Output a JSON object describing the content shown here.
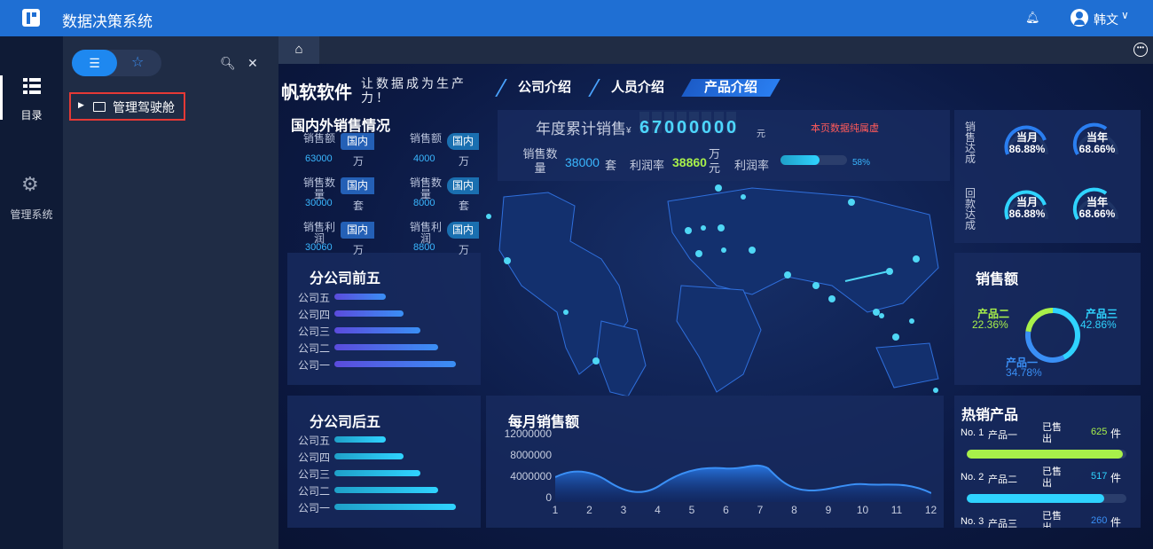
{
  "topbar": {
    "title": "数据决策系统",
    "user": "韩文"
  },
  "nav": {
    "directory": "目录",
    "manage": "管理系统"
  },
  "tree": {
    "item": "管理驾驶舱"
  },
  "dash": {
    "brand": "帆软软件",
    "slogan": "让数据成为生产力！",
    "tabs": [
      "公司介绍",
      "人员介绍",
      "产品介绍"
    ],
    "domestic": {
      "title": "国内外销售情况",
      "rows": [
        {
          "l1": "销售额",
          "v1": "63000",
          "u1": "万",
          "l2": "销售额",
          "v2": "4000",
          "u2": "万"
        },
        {
          "l1": "销售数量",
          "v1": "30000",
          "u1": "套",
          "l2": "销售数量",
          "v2": "8000",
          "u2": "套"
        },
        {
          "l1": "销售利润",
          "v1": "30060",
          "u1": "万",
          "l2": "销售利润",
          "v2": "8800",
          "u2": "万"
        }
      ],
      "pill": "国内"
    },
    "annual": {
      "title": "年度累计销售",
      "currency": "¥",
      "digits": [
        "6",
        "7",
        "0",
        "0",
        "0",
        "0",
        "0",
        "0"
      ],
      "unit": "元",
      "note": "本页数据纯属虚",
      "qty_label": "销售数量",
      "qty": "38000",
      "qty_unit": "套",
      "profit_label": "利润率",
      "profit": "38860",
      "profit_unit": "万元",
      "rate_label": "利润率",
      "rate": "58%",
      "rate_value": 0.58
    },
    "top5": {
      "title": "分公司前五",
      "items": [
        "公司五",
        "公司四",
        "公司三",
        "公司二",
        "公司一"
      ],
      "values": [
        58,
        78,
        97,
        117,
        137
      ]
    },
    "bottom5": {
      "title": "分公司后五",
      "items": [
        "公司五",
        "公司四",
        "公司三",
        "公司二",
        "公司一"
      ],
      "values": [
        58,
        78,
        97,
        117,
        137
      ]
    },
    "monthly": {
      "title": "每月销售额",
      "yticks": [
        "12000000",
        "8000000",
        "4000000",
        "0"
      ],
      "xticks": [
        "1",
        "2",
        "3",
        "4",
        "5",
        "6",
        "7",
        "8",
        "9",
        "10",
        "11",
        "12"
      ]
    },
    "gauges": {
      "sales_label": "销售达成",
      "return_label": "回款达成",
      "month": "当月",
      "year": "当年",
      "v1": "86.88%",
      "v2": "68.66%"
    },
    "pie": {
      "title": "销售额",
      "items": [
        {
          "name": "产品二",
          "value": "22.36%",
          "color": "#a8f04a"
        },
        {
          "name": "产品三",
          "value": "42.86%",
          "color": "#2fd3ff"
        },
        {
          "name": "产品一",
          "value": "34.78%",
          "color": "#3a8ff5"
        }
      ]
    },
    "hot": {
      "title": "热销产品",
      "sold": "已售出",
      "unit": "件",
      "items": [
        {
          "rank": "No. 1",
          "name": "产品一",
          "value": "625",
          "color": "#a8f04a",
          "frac": 0.98
        },
        {
          "rank": "No. 2",
          "name": "产品二",
          "value": "517",
          "color": "#2fd3ff",
          "frac": 0.86
        },
        {
          "rank": "No. 3",
          "name": "产品三",
          "value": "260",
          "color": "#3a8ff5",
          "frac": 0.5
        }
      ]
    }
  }
}
